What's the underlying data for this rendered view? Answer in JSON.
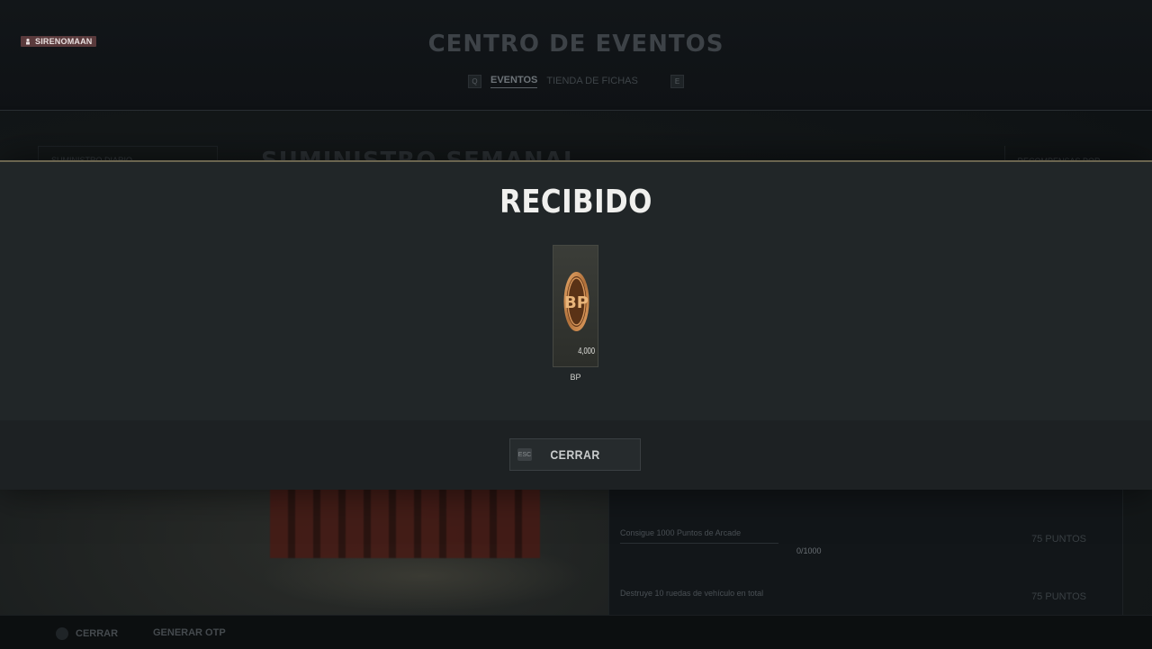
{
  "background": {
    "user": {
      "name": "SIRENOMAAN"
    },
    "header": {
      "title": "CENTRO DE EVENTOS",
      "tabs": [
        {
          "label": "EVENTOS",
          "active": true
        },
        {
          "label": "TIENDA DE FICHAS",
          "active": false
        }
      ],
      "key_left": "Q",
      "key_right": "E"
    },
    "left_panel_label": "SUMINISTRO DIARIO",
    "section_heading": "SUMINISTRO SEMANAL",
    "right_panel_label": "RECOMPENSAS POR",
    "missions": [
      {
        "text": "Consigue 1000 Puntos de Arcade",
        "progress": "0/1000",
        "points": "75 PUNTOS"
      },
      {
        "text": "Destruye 10 ruedas de vehículo en total",
        "points": "75 PUNTOS"
      }
    ],
    "footer": {
      "close_label": "CERRAR",
      "otp_label": "GENERAR OTP"
    }
  },
  "modal": {
    "title": "RECIBIDO",
    "reward": {
      "icon": "bp-coin-icon",
      "quantity": "4,000",
      "label": "BP"
    },
    "close_button": {
      "key": "ESC",
      "label": "CERRAR"
    }
  },
  "colors": {
    "modal_bg": "#212628",
    "modal_accent": "#6b6550",
    "coin": "#c8894a",
    "user_tag": "#5a3a3c"
  }
}
